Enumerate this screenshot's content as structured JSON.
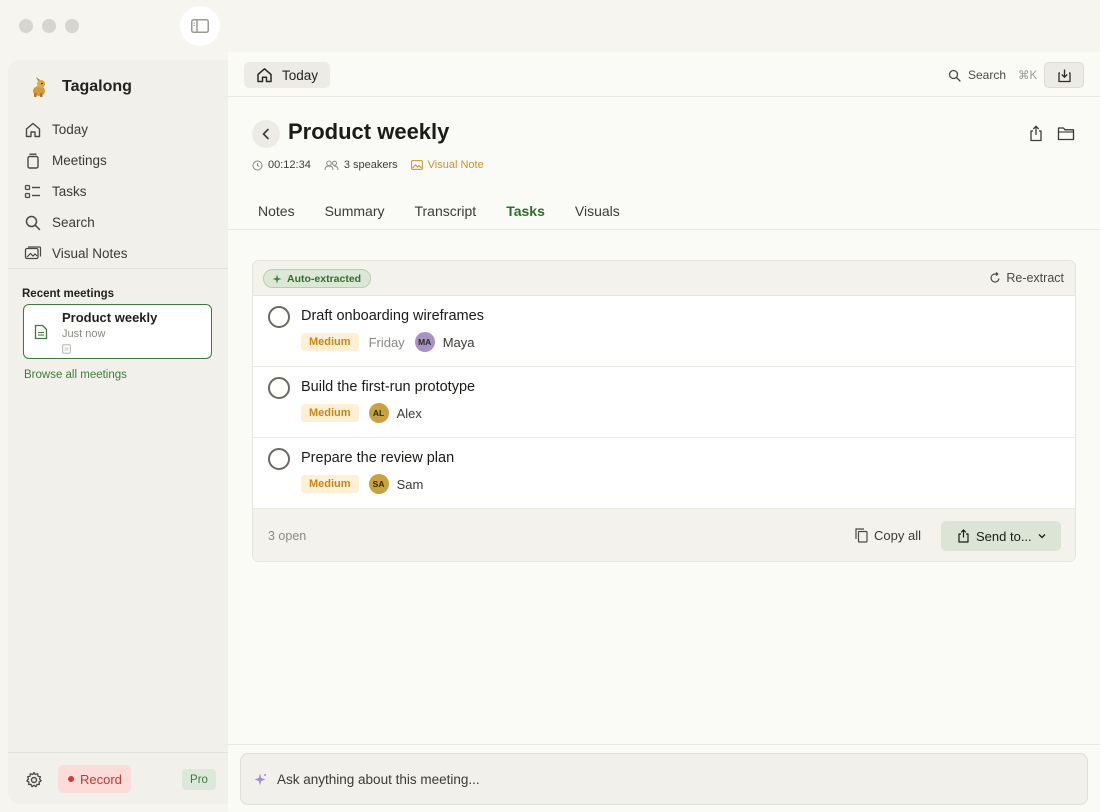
{
  "app": {
    "name": "Tagalong"
  },
  "sidebar": {
    "items": [
      {
        "label": "Today",
        "icon": "home-icon"
      },
      {
        "label": "Meetings",
        "icon": "stack-icon"
      },
      {
        "label": "Tasks",
        "icon": "tasks-icon"
      },
      {
        "label": "Search",
        "icon": "search-icon"
      },
      {
        "label": "Visual Notes",
        "icon": "images-icon"
      }
    ],
    "recent_heading": "Recent meetings",
    "recent": [
      {
        "title": "Product weekly",
        "subtitle": "Just now"
      }
    ],
    "browse_label": "Browse all meetings",
    "record_label": "Record",
    "plan_badge": "Pro"
  },
  "topbar": {
    "crumb_label": "Today",
    "search_label": "Search",
    "search_shortcut": "⌘K"
  },
  "meeting": {
    "title": "Product weekly",
    "duration": "00:12:34",
    "speakers": "3 speakers",
    "visual_note": "Visual Note"
  },
  "tabs": [
    {
      "label": "Notes",
      "active": false
    },
    {
      "label": "Summary",
      "active": false
    },
    {
      "label": "Transcript",
      "active": false
    },
    {
      "label": "Tasks",
      "active": true
    },
    {
      "label": "Visuals",
      "active": false
    }
  ],
  "tasks_panel": {
    "badge": "Auto-extracted",
    "reextract_label": "Re-extract",
    "tasks": [
      {
        "title": "Draft onboarding wireframes",
        "priority": "Medium",
        "due": "Friday",
        "initials": "MA",
        "assignee": "Maya",
        "avatar_color": "#a892c4"
      },
      {
        "title": "Build the first-run prototype",
        "priority": "Medium",
        "due": "",
        "initials": "AL",
        "assignee": "Alex",
        "avatar_color": "#c9a13d"
      },
      {
        "title": "Prepare the review plan",
        "priority": "Medium",
        "due": "",
        "initials": "SA",
        "assignee": "Sam",
        "avatar_color": "#c9a13d"
      }
    ],
    "open_count": "3 open",
    "copy_all_label": "Copy all",
    "send_label": "Send to..."
  },
  "ask": {
    "placeholder": "Ask anything about this meeting..."
  },
  "colors": {
    "accent": "#3e7a3f",
    "priority": "#c8861a",
    "record": "#c7372d"
  }
}
